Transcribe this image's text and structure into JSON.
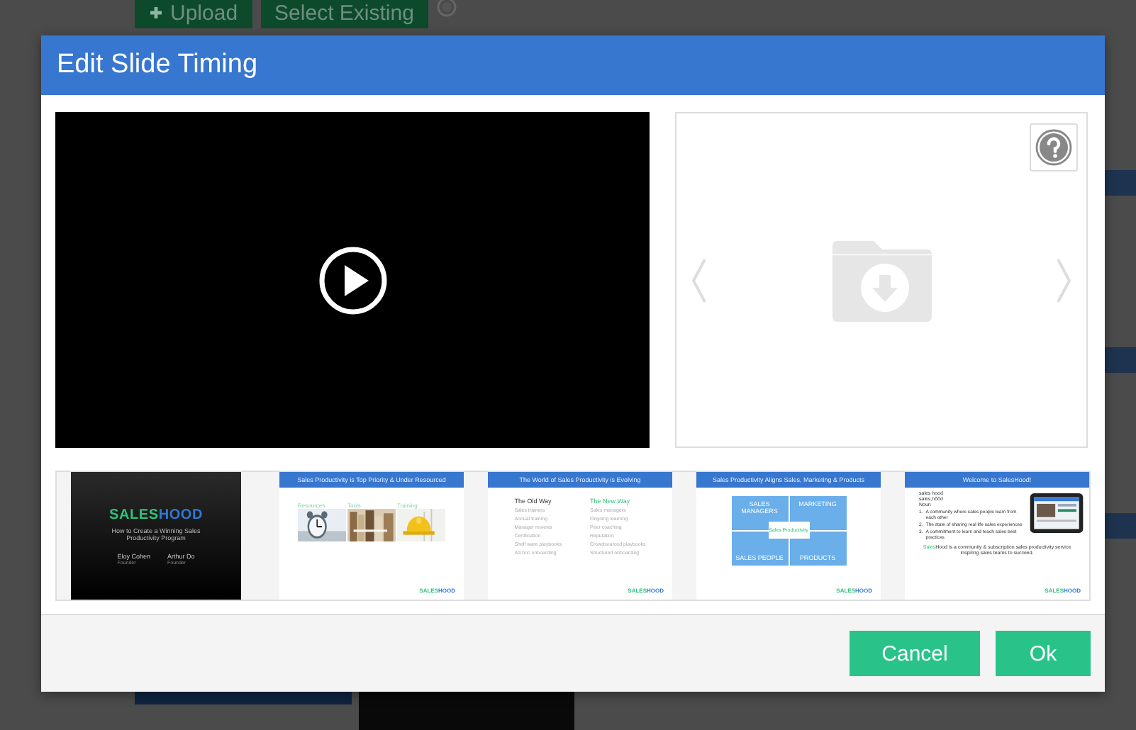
{
  "background": {
    "buttons": [
      {
        "label": "Upload"
      },
      {
        "label": "Select Existing"
      }
    ]
  },
  "window": {
    "title": "Edit Slide Timing"
  },
  "slides": [
    {
      "kind": "title",
      "logo": [
        "SALES",
        "HOOD"
      ],
      "subtitle": "How to Create a Winning Sales Productivity Program",
      "people": [
        {
          "name": "Eloy Cohen",
          "role": "Founder"
        },
        {
          "name": "Arthur Do",
          "role": "Founder"
        }
      ]
    },
    {
      "kind": "pictures",
      "heading": "Sales Productivity is Top Priority & Under Resourced",
      "columns": [
        "Resources",
        "Tools",
        "Training"
      ],
      "logo": [
        "SALES",
        "HOOD"
      ]
    },
    {
      "kind": "columns",
      "heading": "The World of Sales Productivity is Evolving",
      "columns": [
        {
          "title": "The Old Way",
          "items": [
            "Sales trainers",
            "Annual training",
            "Manager reviews",
            "Certification",
            "Shelf ware playbooks",
            "Ad-hoc onboarding"
          ]
        },
        {
          "title": "The New Way",
          "items": [
            "Sales managers",
            "Ongoing learning",
            "Peer coaching",
            "Reputation",
            "Crowdsourced playbooks",
            "Structured onboarding"
          ]
        }
      ],
      "logo": [
        "SALES",
        "HOOD"
      ]
    },
    {
      "kind": "diagram",
      "heading": "Sales Productivity Aligns Sales, Marketing & Products",
      "quadrants": [
        "SALES MANAGERS",
        "MARKETING",
        "SALES PEOPLE",
        "PRODUCTS"
      ],
      "center": "Sales Productivity",
      "logo": [
        "SALES",
        "HOOD"
      ]
    },
    {
      "kind": "welcome",
      "heading": "Welcome to SalesHood!",
      "definition": [
        "sales hood",
        "sales,hŏŏd",
        "Noun"
      ],
      "points": [
        {
          "number": "1.",
          "text": "A community where sales people learn from each other"
        },
        {
          "number": "2.",
          "text": "The state of sharing real life sales experiences"
        },
        {
          "number": "3.",
          "text": "A commitment to learn and teach sales best practices"
        }
      ],
      "tagline": [
        "Sales",
        "Hood is a community & subscription sales productivity service inspiring sales teams to succeed."
      ],
      "logo": [
        "SALES",
        "HOOD"
      ]
    }
  ],
  "buttons": [
    {
      "label": "Cancel"
    },
    {
      "label": "Ok"
    }
  ]
}
